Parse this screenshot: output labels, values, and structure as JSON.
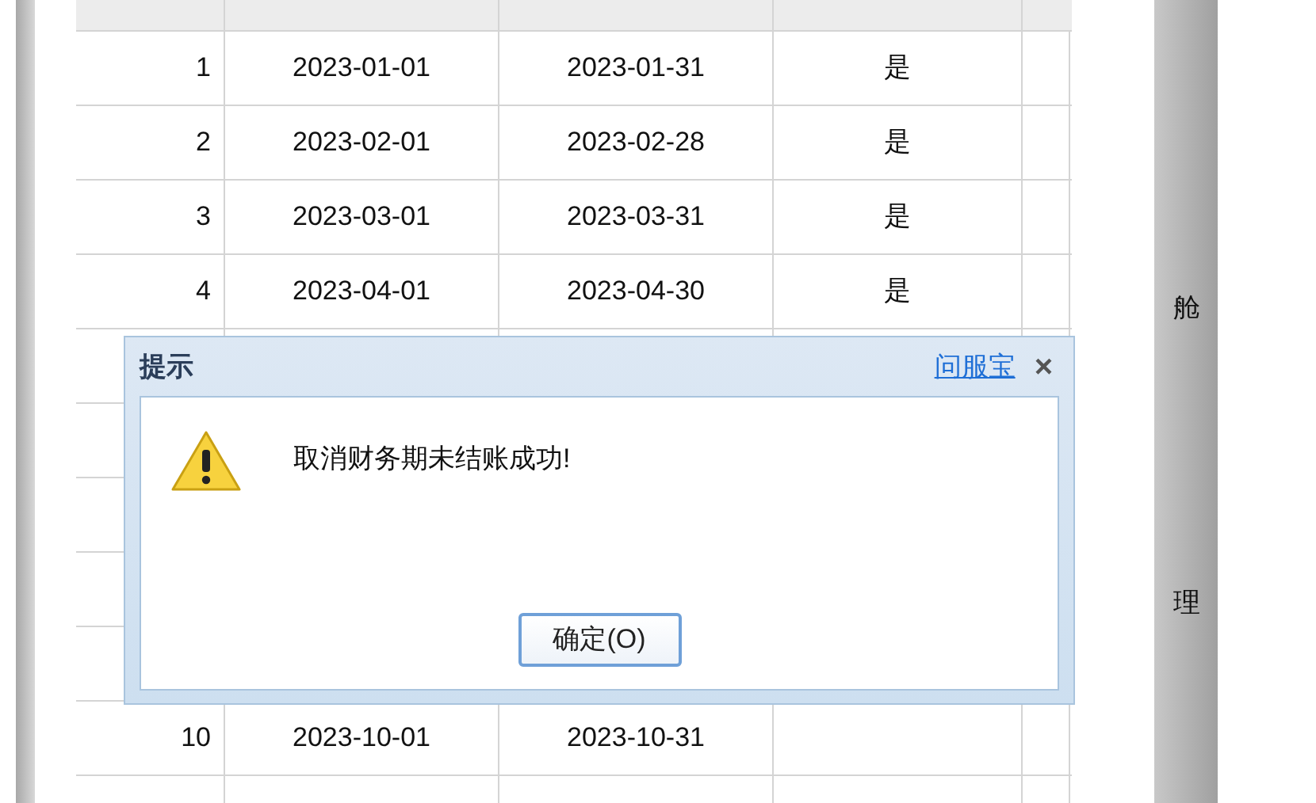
{
  "table": {
    "rows": [
      {
        "index": "1",
        "start": "2023-01-01",
        "end": "2023-01-31",
        "closed": "是"
      },
      {
        "index": "2",
        "start": "2023-02-01",
        "end": "2023-02-28",
        "closed": "是"
      },
      {
        "index": "3",
        "start": "2023-03-01",
        "end": "2023-03-31",
        "closed": "是"
      },
      {
        "index": "4",
        "start": "2023-04-01",
        "end": "2023-04-30",
        "closed": "是"
      },
      {
        "index": "10",
        "start": "2023-10-01",
        "end": "2023-10-31"
      }
    ]
  },
  "side_fragments": [
    "舱",
    "理"
  ],
  "dialog": {
    "title": "提示",
    "help_link": "问服宝",
    "close": "×",
    "message": "取消财务期未结账成功!",
    "ok_button": "确定(O)"
  }
}
